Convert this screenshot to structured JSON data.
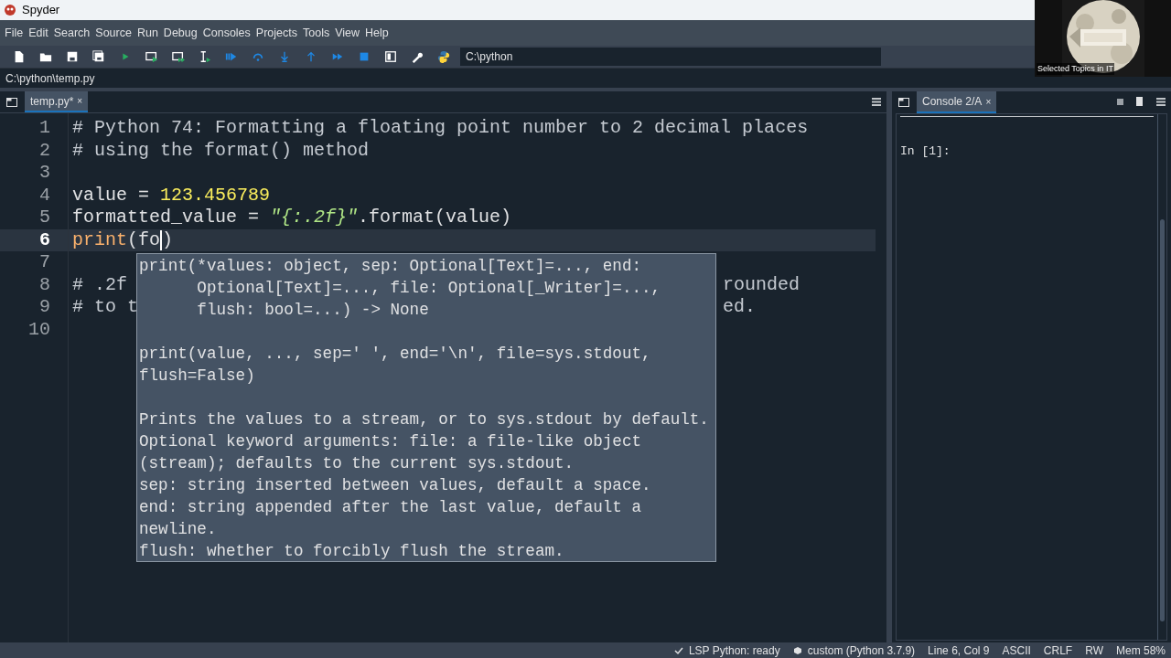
{
  "window": {
    "title": "Spyder"
  },
  "menu": [
    "File",
    "Edit",
    "Search",
    "Source",
    "Run",
    "Debug",
    "Consoles",
    "Projects",
    "Tools",
    "View",
    "Help"
  ],
  "toolbar": {
    "working_directory": "C:\\python"
  },
  "file_path": "C:\\python\\temp.py",
  "editor": {
    "tabs": [
      {
        "label": "temp.py*",
        "close": "×",
        "selected": true
      }
    ],
    "lines": [
      {
        "number": "1",
        "current": false,
        "segments": [
          {
            "text": "# Python 74: Formatting a floating point number to 2 decimal places",
            "kind": "comment"
          }
        ]
      },
      {
        "number": "2",
        "current": false,
        "segments": [
          {
            "text": "# using the format() method",
            "kind": "comment"
          }
        ]
      },
      {
        "number": "3",
        "current": false
      },
      {
        "number": "4",
        "current": false,
        "segments": [
          {
            "text": "value = ",
            "kind": "plain"
          },
          {
            "text": "123.456789",
            "kind": "number"
          }
        ]
      },
      {
        "number": "5",
        "current": false,
        "segments": [
          {
            "text": "formatted_value = ",
            "kind": "plain"
          },
          {
            "text": "\"{:.2f}\"",
            "kind": "string"
          },
          {
            "text": ".format(value)",
            "kind": "plain"
          }
        ]
      },
      {
        "number": "6",
        "current": true,
        "segments": [
          {
            "text": "print",
            "kind": "builtin"
          },
          {
            "text": "(fo",
            "kind": "plain"
          },
          {
            "kind": "cursor"
          },
          {
            "text": ")",
            "kind": "plain"
          }
        ]
      },
      {
        "number": "7",
        "current": false
      },
      {
        "number": "8",
        "current": false,
        "segments": [
          {
            "text": "# .2f",
            "kind": "comment"
          },
          {
            "text": "rounded",
            "kind": "tail"
          }
        ]
      },
      {
        "number": "9",
        "current": false,
        "segments": [
          {
            "text": "# to t",
            "kind": "comment"
          },
          {
            "text": "ed.",
            "kind": "tail"
          }
        ]
      },
      {
        "number": "10",
        "current": false
      }
    ],
    "popup": {
      "signature": [
        "print(*values: object, sep: Optional[Text]=..., end:",
        "      Optional[Text]=..., file: Optional[_Writer]=...,",
        "      flush: bool=...) -> None"
      ],
      "usage": [
        "print(value, ..., sep=' ', end='\\n', file=sys.stdout,",
        "flush=False)"
      ],
      "doc": [
        "Prints the values to a stream, or to sys.stdout by default.",
        "Optional keyword arguments: file: a file-like object",
        "(stream); defaults to the current sys.stdout.",
        "sep: string inserted between values, default a space.",
        "end: string appended after the last value, default a",
        "newline.",
        "flush: whether to forcibly flush the stream."
      ]
    }
  },
  "console": {
    "tabs": [
      {
        "label": "Console 2/A",
        "close": "×",
        "selected": true
      }
    ],
    "prompt": "In [1]:"
  },
  "status_bar": [
    {
      "text": "LSP Python: ready"
    },
    {
      "text": "custom (Python 3.7.9)"
    },
    {
      "text": "Line 6, Col 9"
    },
    {
      "text": "ASCII"
    },
    {
      "text": "CRLF"
    },
    {
      "text": "RW"
    },
    {
      "text": "Mem 58%"
    }
  ],
  "webcam": {
    "caption": "Selected Topics in IT"
  }
}
